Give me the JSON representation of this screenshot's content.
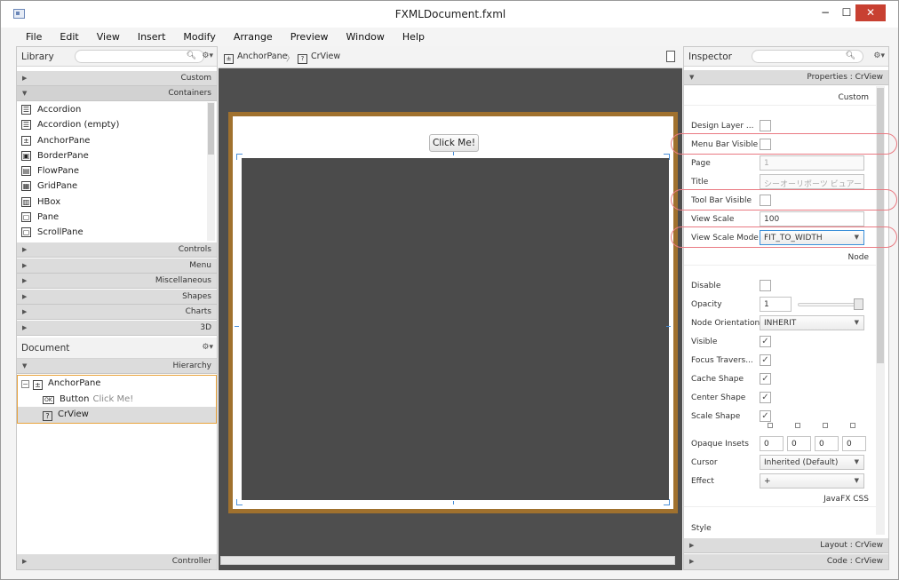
{
  "window": {
    "title": "FXMLDocument.fxml",
    "minimize": "−",
    "maximize": "☐",
    "close": "✕"
  },
  "menu": [
    "File",
    "Edit",
    "View",
    "Insert",
    "Modify",
    "Arrange",
    "Preview",
    "Window",
    "Help"
  ],
  "library": {
    "title": "Library",
    "sections_top": [
      {
        "label": "Custom"
      },
      {
        "label": "Containers"
      }
    ],
    "items": [
      "Accordion",
      "Accordion  (empty)",
      "AnchorPane",
      "BorderPane",
      "FlowPane",
      "GridPane",
      "HBox",
      "Pane",
      "ScrollPane"
    ],
    "sections_bottom": [
      "Controls",
      "Menu",
      "Miscellaneous",
      "Shapes",
      "Charts",
      "3D"
    ]
  },
  "document": {
    "title": "Document",
    "hierarchy_label": "Hierarchy",
    "tree": [
      {
        "name": "AnchorPane",
        "sub": ""
      },
      {
        "name": "Button",
        "sub": "Click Me!"
      },
      {
        "name": "CrView",
        "sub": ""
      }
    ],
    "controller_label": "Controller"
  },
  "center": {
    "breadcrumb": [
      "AnchorPane",
      "CrView"
    ],
    "button_label": "Click Me!"
  },
  "inspector": {
    "title": "Inspector",
    "properties_header": "Properties : CrView",
    "custom_label": "Custom",
    "custom_props": [
      {
        "label": "Design Layer ...",
        "type": "check",
        "value": ""
      },
      {
        "label": "Menu Bar Visible",
        "type": "check",
        "value": ""
      },
      {
        "label": "Page",
        "type": "text",
        "value": "1",
        "disabled": true
      },
      {
        "label": "Title",
        "type": "text",
        "value": "シーオーリポーツ ビュアー",
        "disabled": true
      },
      {
        "label": "Tool Bar Visible",
        "type": "check",
        "value": ""
      },
      {
        "label": "View Scale",
        "type": "text",
        "value": "100"
      },
      {
        "label": "View Scale Mode",
        "type": "select",
        "value": "FIT_TO_WIDTH"
      }
    ],
    "node_label": "Node",
    "node_props": [
      {
        "label": "Disable",
        "type": "check",
        "value": ""
      },
      {
        "label": "Opacity",
        "type": "slider",
        "value": "1"
      },
      {
        "label": "Node Orientation",
        "type": "select",
        "value": "INHERIT"
      },
      {
        "label": "Visible",
        "type": "check",
        "value": "✓"
      },
      {
        "label": "Focus Travers...",
        "type": "check",
        "value": "✓"
      },
      {
        "label": "Cache Shape",
        "type": "check",
        "value": "✓"
      },
      {
        "label": "Center Shape",
        "type": "check",
        "value": "✓"
      },
      {
        "label": "Scale Shape",
        "type": "check",
        "value": "✓"
      },
      {
        "label": "Opaque Insets",
        "type": "insets",
        "value": [
          "0",
          "0",
          "0",
          "0"
        ]
      },
      {
        "label": "Cursor",
        "type": "select",
        "value": "Inherited (Default)"
      },
      {
        "label": "Effect",
        "type": "select",
        "value": "+"
      }
    ],
    "css_label": "JavaFX CSS",
    "style_label": "Style",
    "layout_header": "Layout : CrView",
    "code_header": "Code : CrView"
  },
  "colors": {
    "highlight": "#ea7a82",
    "selection_border": "#e8a33c",
    "stage_border": "#a0712e"
  }
}
